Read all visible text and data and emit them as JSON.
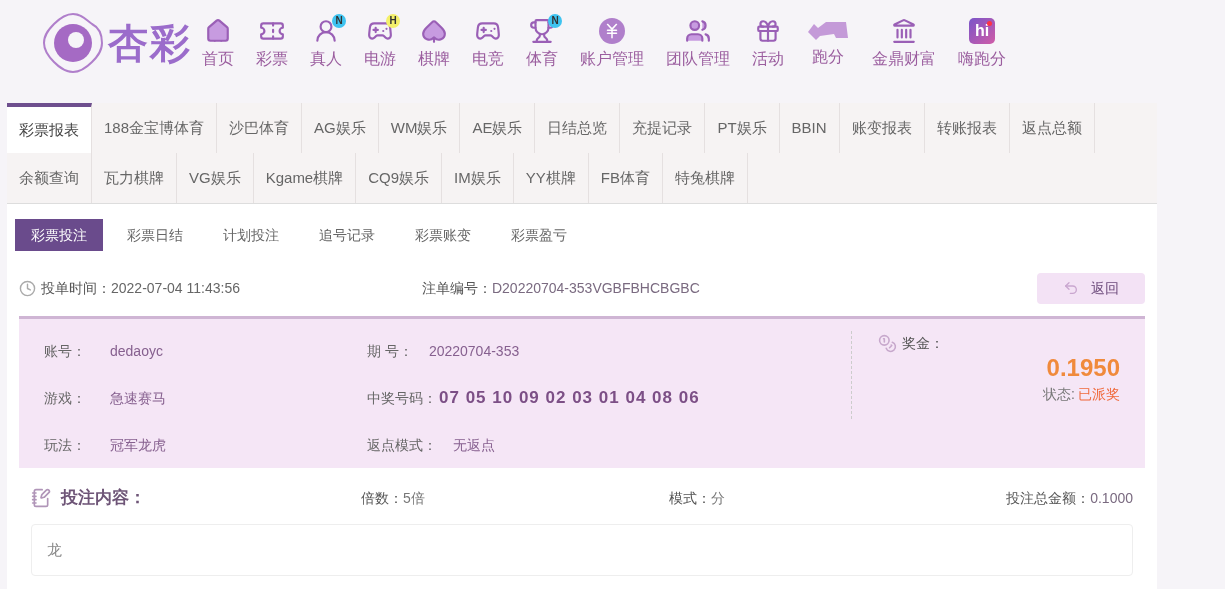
{
  "logo": {
    "text": "杏彩"
  },
  "nav": [
    {
      "label": "首页"
    },
    {
      "label": "彩票"
    },
    {
      "label": "真人",
      "badge": {
        "text": "N",
        "color": "#3ec3f0"
      }
    },
    {
      "label": "电游",
      "badge": {
        "text": "H",
        "color": "#f4f06a"
      }
    },
    {
      "label": "棋牌"
    },
    {
      "label": "电竞"
    },
    {
      "label": "体育",
      "badge": {
        "text": "N",
        "color": "#3ec3f0"
      }
    },
    {
      "label": "账户管理"
    },
    {
      "label": "团队管理"
    },
    {
      "label": "活动"
    },
    {
      "label": "跑分"
    },
    {
      "label": "金鼎财富"
    },
    {
      "label": "嗨跑分",
      "icon_text": "hi"
    }
  ],
  "report_tabs": [
    [
      {
        "label": "彩票报表",
        "selected": true
      },
      {
        "label": "188金宝博体育",
        "selected": false
      },
      {
        "label": "沙巴体育",
        "selected": false
      },
      {
        "label": "AG娱乐",
        "selected": false
      },
      {
        "label": "WM娱乐",
        "selected": false
      },
      {
        "label": "AE娱乐",
        "selected": false
      },
      {
        "label": "日结总览",
        "selected": false
      },
      {
        "label": "充提记录",
        "selected": false
      },
      {
        "label": "PT娱乐",
        "selected": false
      },
      {
        "label": "BBIN",
        "selected": false
      },
      {
        "label": "账变报表",
        "selected": false
      },
      {
        "label": "转账报表",
        "selected": false
      },
      {
        "label": "返点总额",
        "selected": false
      }
    ],
    [
      {
        "label": "余额查询",
        "selected": false
      },
      {
        "label": "瓦力棋牌",
        "selected": false
      },
      {
        "label": "VG娱乐",
        "selected": false
      },
      {
        "label": "Kgame棋牌",
        "selected": false
      },
      {
        "label": "CQ9娱乐",
        "selected": false
      },
      {
        "label": "IM娱乐",
        "selected": false
      },
      {
        "label": "YY棋牌",
        "selected": false
      },
      {
        "label": "FB体育",
        "selected": false
      },
      {
        "label": "特兔棋牌",
        "selected": false
      }
    ]
  ],
  "sub_tabs": [
    {
      "label": "彩票投注",
      "selected": true
    },
    {
      "label": "彩票日结",
      "selected": false
    },
    {
      "label": "计划投注",
      "selected": false
    },
    {
      "label": "追号记录",
      "selected": false
    },
    {
      "label": "彩票账变",
      "selected": false
    },
    {
      "label": "彩票盈亏",
      "selected": false
    }
  ],
  "order": {
    "time_label": "投单时间：",
    "time": "2022-07-04 11:43:56",
    "number_label": "注单编号：",
    "number": "D20220704-353VGBFBHCBGBC",
    "back_button": "返回"
  },
  "details": [
    {
      "label": "账号：",
      "value": "dedaoyc"
    },
    {
      "label": "期 号：",
      "value": "20220704-353"
    },
    {
      "label": "游戏：",
      "value": "急速赛马"
    },
    {
      "label": "中奖号码：",
      "value": "07 05 10 09 02 03 01 04 08 06",
      "kind": "numbers"
    },
    {
      "label": "玩法：",
      "value": "冠军龙虎"
    },
    {
      "label": "返点模式：",
      "value": "无返点"
    }
  ],
  "prize": {
    "label": "奖金：",
    "amount": "0.1950",
    "status_label": "状态:",
    "status": "已派奖"
  },
  "bet": {
    "title": "投注内容：",
    "multiplier_label": "倍数：",
    "multiplier": "5倍",
    "mode_label": "模式：",
    "mode": "分",
    "total_label": "投注总金额：",
    "total": "0.1000",
    "content": "龙"
  }
}
